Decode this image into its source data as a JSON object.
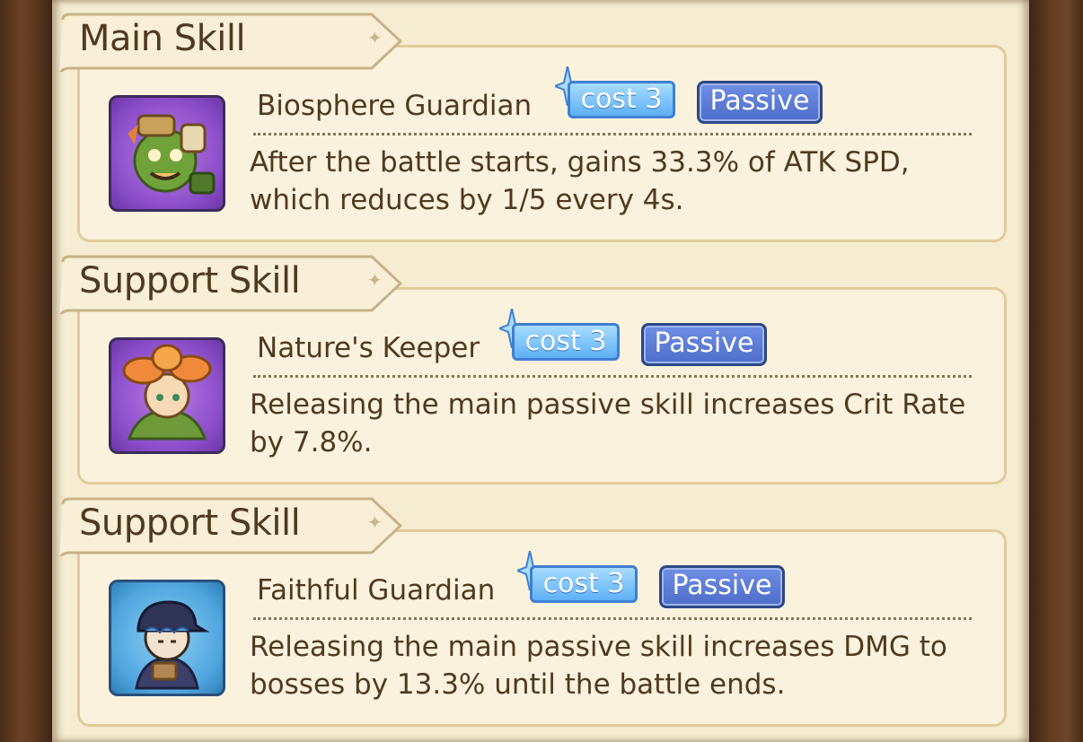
{
  "sections": [
    {
      "header": "Main Skill",
      "skill_name": "Biosphere Guardian",
      "cost_label": "cost 3",
      "type_badge": "Passive",
      "description": "After the battle starts, gains 33.3% of ATK SPD, which reduces by 1/5 every 4s.",
      "icon": "plant-robot-guardian-icon"
    },
    {
      "header": "Support Skill",
      "skill_name": "Nature's Keeper",
      "cost_label": "cost 3",
      "type_badge": "Passive",
      "description": "Releasing the main passive skill increases Crit Rate by 7.8%.",
      "icon": "flower-girl-icon"
    },
    {
      "header": "Support Skill",
      "skill_name": "Faithful Guardian",
      "cost_label": "cost 3",
      "type_badge": "Passive",
      "description": "Releasing the main passive skill increases DMG to bosses by 13.3% until the battle ends.",
      "icon": "capped-boy-icon"
    }
  ],
  "colors": {
    "panel_bg": "#f5ecd1",
    "text": "#4f3a20",
    "cost_blue": "#5eb0f5",
    "passive_blue": "#4d6dc9"
  }
}
